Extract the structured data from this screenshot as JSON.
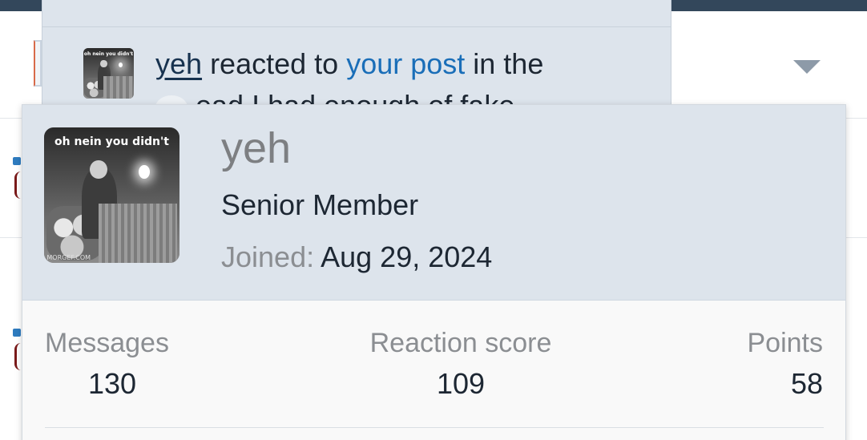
{
  "alert": {
    "avatar_caption": "oh nein you didn't",
    "user": "yeh",
    "reacted_text": "reacted to",
    "post_link": "your post",
    "in_text": "in the",
    "clipped_text": "ead I had enough of fake"
  },
  "member_card": {
    "avatar_caption": "oh nein you didn't",
    "avatar_watermark": "MORGEF.COM",
    "username": "yeh",
    "user_title": "Senior Member",
    "joined_label": "Joined:",
    "joined_date": "Aug 29, 2024",
    "stats": {
      "messages_label": "Messages",
      "messages_value": "130",
      "reaction_label": "Reaction score",
      "reaction_value": "109",
      "points_label": "Points",
      "points_value": "58"
    }
  },
  "colors": {
    "topbar": "#33475b",
    "panel_bg": "#dde4ec",
    "link_blue": "#1a6eb8",
    "username_link": "#17324f",
    "muted_text": "#8b8e92"
  },
  "icons": {
    "dropdown": "caret-down-icon"
  }
}
